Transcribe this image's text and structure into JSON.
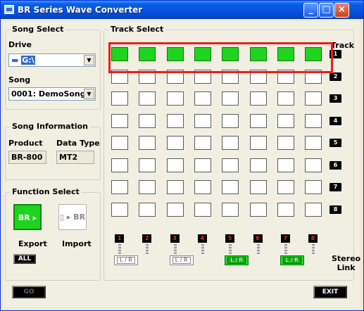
{
  "window": {
    "title": "BR Series Wave Converter",
    "minimize": "_",
    "maximize": "□",
    "close": "×"
  },
  "song_select": {
    "title": "Song Select",
    "drive_label": "Drive",
    "drive_value": "G:\\",
    "song_label": "Song",
    "song_value": "0001: DemoSong"
  },
  "song_info": {
    "title": "Song Information",
    "product_label": "Product",
    "data_type_label": "Data Type",
    "product_value": "BR-800",
    "data_type_value": "MT2"
  },
  "function_select": {
    "title": "Function Select",
    "export_label": "Export",
    "import_label": "Import",
    "export_button": "BR ▸ ▯",
    "import_button": "▯ ▸ BR",
    "all_button": "ALL"
  },
  "track_select": {
    "title": "Track Select",
    "track_header": "Track",
    "tracks": [
      "1",
      "2",
      "3",
      "4",
      "5",
      "6",
      "7",
      "8"
    ],
    "channels": [
      "1",
      "2",
      "3",
      "4",
      "5",
      "6",
      "7",
      "8"
    ],
    "active_track": "1",
    "grid": [
      [
        1,
        1,
        1,
        1,
        1,
        1,
        1,
        1
      ],
      [
        0,
        0,
        0,
        0,
        0,
        0,
        0,
        0
      ],
      [
        0,
        0,
        0,
        0,
        0,
        0,
        0,
        0
      ],
      [
        0,
        0,
        0,
        0,
        0,
        0,
        0,
        0
      ],
      [
        0,
        0,
        0,
        0,
        0,
        0,
        0,
        0
      ],
      [
        0,
        0,
        0,
        0,
        0,
        0,
        0,
        0
      ],
      [
        0,
        0,
        0,
        0,
        0,
        0,
        0,
        0
      ],
      [
        0,
        0,
        0,
        0,
        0,
        0,
        0,
        0
      ]
    ],
    "stereo_link": [
      {
        "label": "L / R",
        "on": false
      },
      {
        "label": "L / R",
        "on": false
      },
      {
        "label": "L / R",
        "on": true
      },
      {
        "label": "L / R",
        "on": true
      }
    ],
    "stereo_link_label_1": "Stereo",
    "stereo_link_label_2": "Link"
  },
  "bottom": {
    "go_button": "GO",
    "exit_button": "EXIT"
  },
  "colors": {
    "active": "#1fd41f",
    "highlight": "#ee1c1c"
  }
}
